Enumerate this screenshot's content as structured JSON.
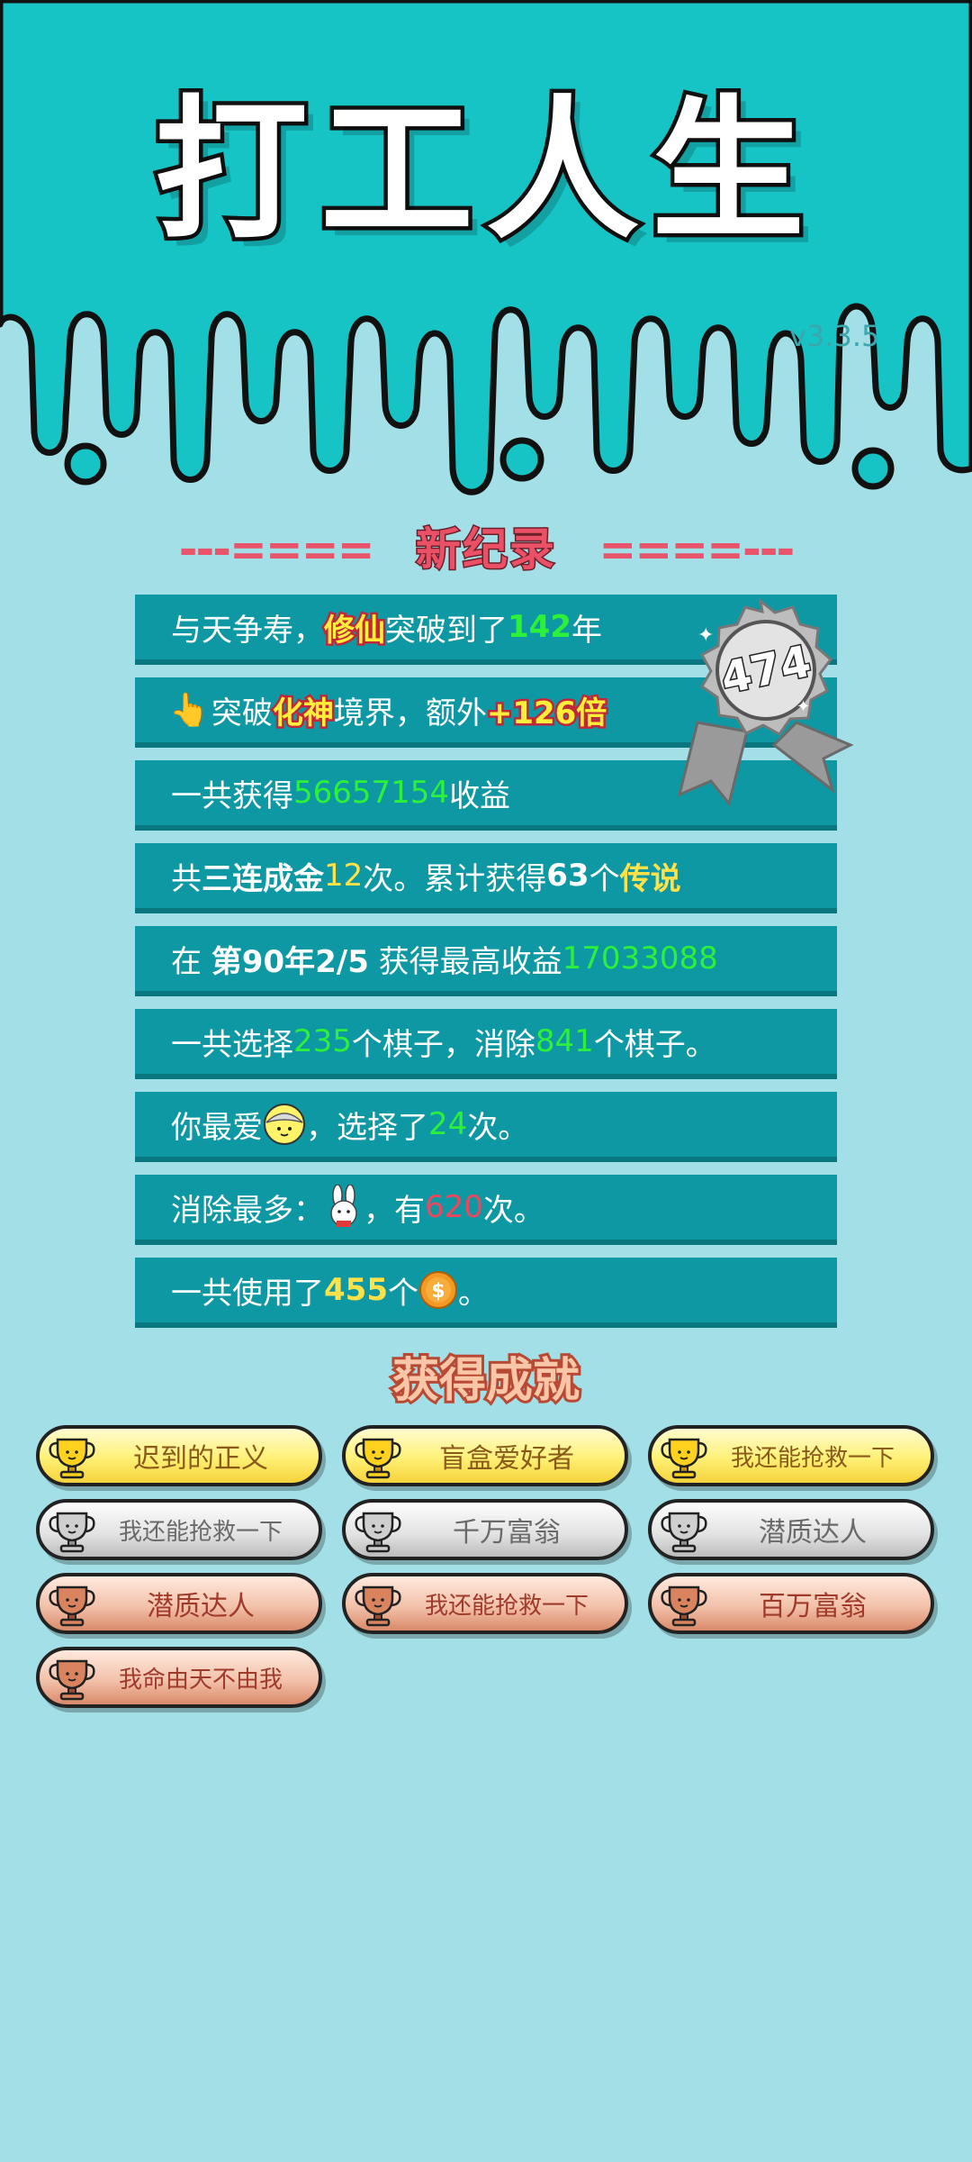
{
  "header": {
    "title": "打工人生",
    "version": "v3.3.5"
  },
  "new_record": {
    "left_deco": "---====",
    "title": "新纪录",
    "right_deco": "====---"
  },
  "medal": {
    "value": "474"
  },
  "stats": {
    "r1": {
      "a": "与天争寿，",
      "b": "修仙",
      "c": "突破到了",
      "d": "142",
      "e": "年"
    },
    "r2": {
      "a": "突破",
      "b": "化神",
      "c": "境界，额外",
      "d": "+126倍"
    },
    "r3": {
      "a": "一共获得",
      "b": "56657154",
      "c": "收益"
    },
    "r4": {
      "a": "共",
      "b": "三连成金",
      "c": "12",
      "d": "次。累计获得",
      "e": "63",
      "f": "个",
      "g": "传说"
    },
    "r5": {
      "a": "在 ",
      "b": "第90年2/5",
      "c": " 获得最高收益",
      "d": "17033088"
    },
    "r6": {
      "a": "一共选择",
      "b": "235",
      "c": "个棋子，消除",
      "d": "841",
      "e": "个棋子。"
    },
    "r7": {
      "a": "你最爱",
      "b": "，选择了",
      "c": "24",
      "d": "次。"
    },
    "r8": {
      "a": "消除最多：",
      "b": "，有",
      "c": "620",
      "d": "次。"
    },
    "r9": {
      "a": "一共使用了",
      "b": "455",
      "c": "个",
      "d": "。"
    }
  },
  "achievements": {
    "title": "获得成就",
    "items": [
      {
        "label": "迟到的正义",
        "tier": "gold"
      },
      {
        "label": "盲盒爱好者",
        "tier": "gold"
      },
      {
        "label": "我还能抢救一下",
        "tier": "gold"
      },
      {
        "label": "我还能抢救一下",
        "tier": "silver"
      },
      {
        "label": "千万富翁",
        "tier": "silver"
      },
      {
        "label": "潜质达人",
        "tier": "silver"
      },
      {
        "label": "潜质达人",
        "tier": "bronze"
      },
      {
        "label": "我还能抢救一下",
        "tier": "bronze"
      },
      {
        "label": "百万富翁",
        "tier": "bronze"
      },
      {
        "label": "我命由天不由我",
        "tier": "bronze"
      }
    ]
  },
  "colors": {
    "background": "#a2dfe6",
    "header_teal": "#16c4c6",
    "row_teal": "#0e98a4",
    "highlight_green": "#2cf03a",
    "highlight_yellow": "#ffe14a"
  }
}
